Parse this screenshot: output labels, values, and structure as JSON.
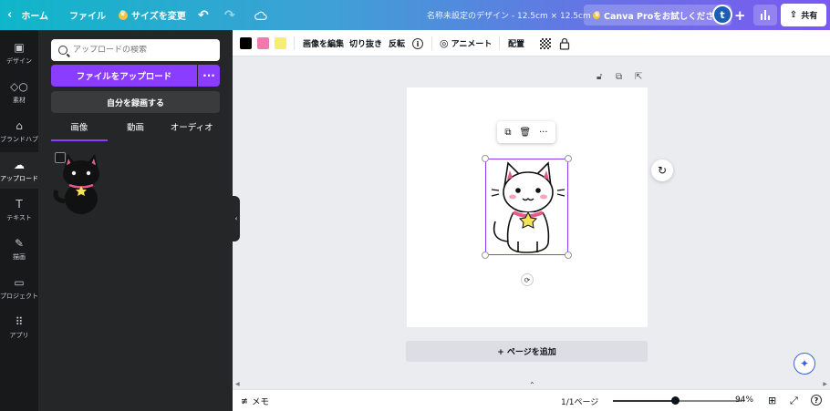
{
  "topbar": {
    "home_label": "ホーム",
    "file_label": "ファイル",
    "resize_label": "サイズを変更",
    "title": "名称未設定のデザイン - 12.5cm × 12.5cm",
    "pro_label": "Canva Proをお試しください",
    "avatar_initial": "t",
    "share_label": "共有"
  },
  "rail": {
    "items": [
      {
        "label": "デザイン",
        "icon": "layout-icon"
      },
      {
        "label": "素材",
        "icon": "elements-icon"
      },
      {
        "label": "ブランドハブ",
        "icon": "brand-icon"
      },
      {
        "label": "アップロード",
        "icon": "upload-icon"
      },
      {
        "label": "テキスト",
        "icon": "text-icon"
      },
      {
        "label": "描画",
        "icon": "draw-icon"
      },
      {
        "label": "プロジェクト",
        "icon": "folder-icon"
      },
      {
        "label": "アプリ",
        "icon": "apps-icon"
      }
    ],
    "active_index": 3
  },
  "panel": {
    "search_placeholder": "アップロードの検索",
    "upload_button": "ファイルをアップロード",
    "record_button": "自分を録画する",
    "tabs": [
      "画像",
      "動画",
      "オーディオ"
    ],
    "active_tab": 0
  },
  "context_toolbar": {
    "colors": [
      "#000000",
      "#f279ad",
      "#f5ef6d"
    ],
    "edit_image": "画像を編集",
    "crop": "切り抜き",
    "flip": "反転",
    "animate": "アニメート",
    "position": "配置"
  },
  "canvas": {
    "add_page": "+ ページを追加"
  },
  "bottombar": {
    "notes_label": "メモ",
    "pages": "1/1ページ",
    "zoom": "94%",
    "zoom_fraction": 0.48
  },
  "colors": {
    "accent": "#8b3dff",
    "cat_collar": "#e8588c",
    "cat_star": "#f5e35a"
  }
}
